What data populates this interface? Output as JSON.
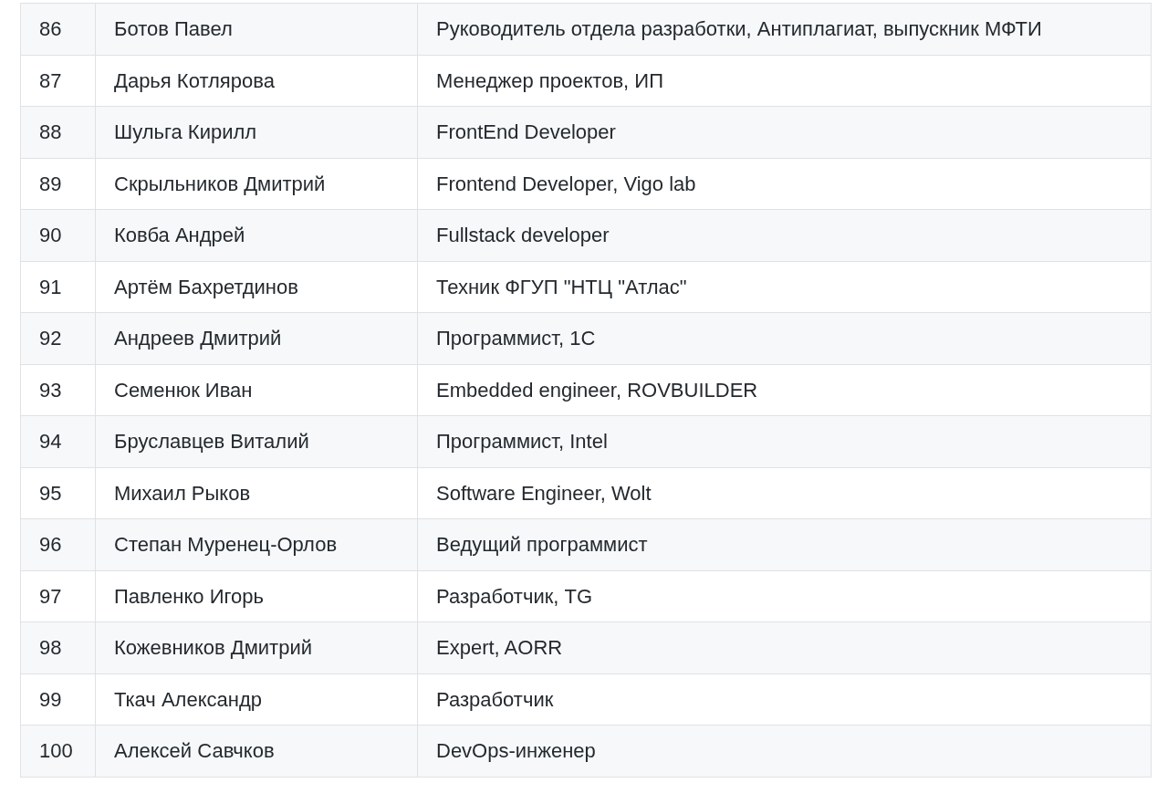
{
  "table": {
    "rows": [
      {
        "number": "86",
        "name": "Ботов Павел",
        "position": "Руководитель отдела разработки, Антиплагиат, выпускник МФТИ"
      },
      {
        "number": "87",
        "name": "Дарья Котлярова",
        "position": "Менеджер проектов, ИП"
      },
      {
        "number": "88",
        "name": "Шульга Кирилл",
        "position": "FrontEnd Developer"
      },
      {
        "number": "89",
        "name": "Скрыльников Дмитрий",
        "position": "Frontend Developer, Vigo lab"
      },
      {
        "number": "90",
        "name": "Ковба Андрей",
        "position": "Fullstack developer"
      },
      {
        "number": "91",
        "name": "Артём Бахретдинов",
        "position": "Техник ФГУП \"НТЦ \"Атлас\""
      },
      {
        "number": "92",
        "name": "Андреев Дмитрий",
        "position": "Программист, 1С"
      },
      {
        "number": "93",
        "name": "Семенюк Иван",
        "position": "Embedded engineer, ROVBUILDER"
      },
      {
        "number": "94",
        "name": "Бруславцев Виталий",
        "position": "Программист, Intel"
      },
      {
        "number": "95",
        "name": "Михаил Рыков",
        "position": "Software Engineer, Wolt"
      },
      {
        "number": "96",
        "name": "Степан Муренец-Орлов",
        "position": "Ведущий программист"
      },
      {
        "number": "97",
        "name": "Павленко Игорь",
        "position": "Разработчик, TG"
      },
      {
        "number": "98",
        "name": "Кожевников Дмитрий",
        "position": "Expert, AORR"
      },
      {
        "number": "99",
        "name": "Ткач Александр",
        "position": "Разработчик"
      },
      {
        "number": "100",
        "name": "Алексей Савчков",
        "position": "DevOps-инженер"
      }
    ]
  }
}
